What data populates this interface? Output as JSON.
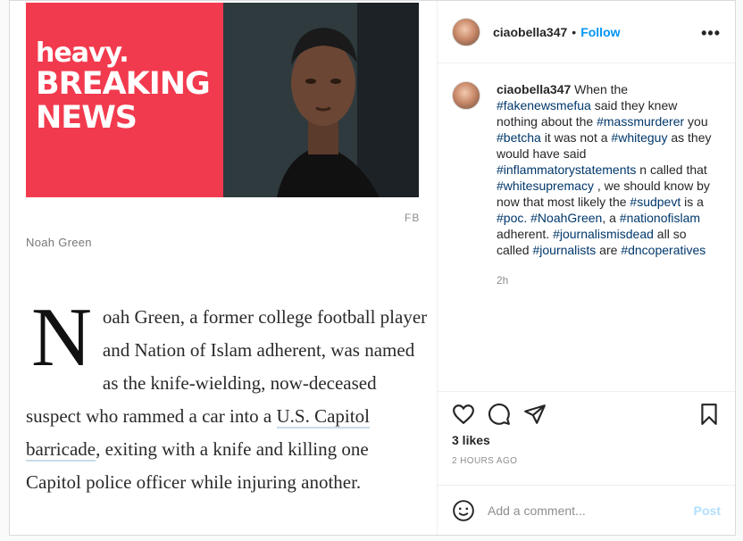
{
  "media": {
    "brand_heavy": "heavy.",
    "brand_line1": "BREAKING",
    "brand_line2": "NEWS",
    "credit": "FB",
    "caption": "Noah Green",
    "dropcap": "N",
    "article_part1": "oah Green, a former college football player and Nation of Islam adherent, was named as the knife-wielding, now-deceased suspect who rammed a car into a ",
    "article_link": "U.S. Capitol barricade",
    "article_part2": ", exiting with a knife and killing one Capitol police officer while injuring another."
  },
  "header": {
    "username": "ciaobella347",
    "dot": "•",
    "follow_label": "Follow",
    "more_label": "•••"
  },
  "comment": {
    "username": "ciaobella347",
    "segments": [
      {
        "t": " When the ",
        "tag": false
      },
      {
        "t": "#fakenewsmefua",
        "tag": true
      },
      {
        "t": " said they knew nothing about the ",
        "tag": false
      },
      {
        "t": "#massmurderer",
        "tag": true
      },
      {
        "t": " you ",
        "tag": false
      },
      {
        "t": "#betcha",
        "tag": true
      },
      {
        "t": " it was not a ",
        "tag": false
      },
      {
        "t": "#whiteguy",
        "tag": true
      },
      {
        "t": " as they would have said ",
        "tag": false
      },
      {
        "t": "#inflammatorystatements",
        "tag": true
      },
      {
        "t": " n called that ",
        "tag": false
      },
      {
        "t": "#whitesupremacy",
        "tag": true
      },
      {
        "t": " , we should know by now that most likely the ",
        "tag": false
      },
      {
        "t": "#sudpevt",
        "tag": true
      },
      {
        "t": " is a ",
        "tag": false
      },
      {
        "t": "#poc.",
        "tag": true
      },
      {
        "t": " ",
        "tag": false
      },
      {
        "t": "#NoahGreen",
        "tag": true
      },
      {
        "t": ", a ",
        "tag": false
      },
      {
        "t": "#nationofislam",
        "tag": true
      },
      {
        "t": " adherent. ",
        "tag": false
      },
      {
        "t": "#journalismisdead",
        "tag": true
      },
      {
        "t": " all so called ",
        "tag": false
      },
      {
        "t": "#journalists",
        "tag": true
      },
      {
        "t": " are ",
        "tag": false
      },
      {
        "t": "#dncoperatives",
        "tag": true
      }
    ],
    "time": "2h"
  },
  "actions": {
    "like_icon": "heart-icon",
    "comment_icon": "comment-icon",
    "share_icon": "paper-plane-icon",
    "save_icon": "bookmark-icon",
    "likes": "3 likes",
    "posted": "2 HOURS AGO"
  },
  "add_comment": {
    "placeholder": "Add a comment...",
    "post_label": "Post",
    "emoji_icon": "smiley-icon"
  },
  "colors": {
    "brand_red": "#f23a4e",
    "link_blue": "#0095f6",
    "hashtag": "#00376b",
    "post_disabled": "#b2dffc"
  }
}
